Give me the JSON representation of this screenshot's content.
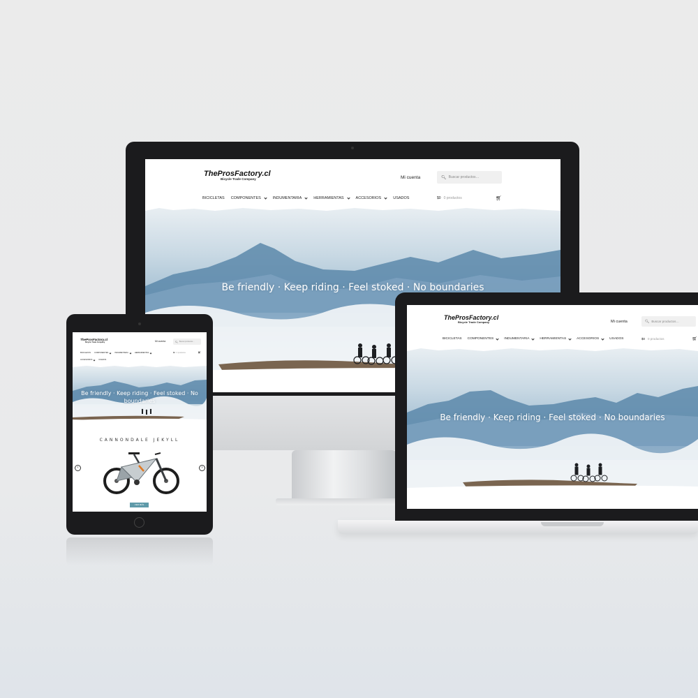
{
  "site": {
    "logo": "TheProsFactory.cl",
    "tagline": "Bicycle Trade Company",
    "account_label": "Mi cuenta",
    "search_placeholder": "Buscar productos…",
    "nav": [
      "BICICLETAS",
      "COMPONENTES",
      "INDUMENTARIA",
      "HERRAMIENTAS",
      "ACCESORIOS",
      "USADOS"
    ],
    "nav_has_dropdown": [
      false,
      true,
      true,
      true,
      true,
      false
    ],
    "cart_amount": "$0",
    "cart_count": "0 productos",
    "hero_text": "Be friendly · Keep riding · Feel stoked · No boundaries"
  },
  "tablet": {
    "account_label": "Mi cuenta",
    "hero_line1": "Be friendly · Keep riding · Feel stoked · No",
    "hero_line2": "boundaries",
    "product_title": "CANNONDALE JEKYLL",
    "cta_label": "VER MÁS",
    "prev_arrow": "‹",
    "next_arrow": "›"
  },
  "colors": {
    "accent": "#5f9aa9",
    "device_black": "#1b1b1d",
    "sky": "#a9c3d5"
  }
}
